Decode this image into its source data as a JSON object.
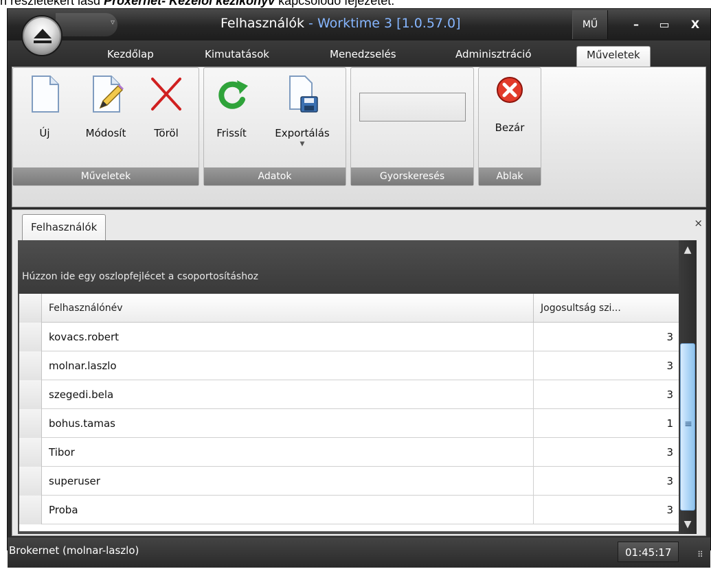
{
  "document_text": {
    "before": "ri részletekért lásd ",
    "bold": "Proxernet- Kezelői kézikönyv",
    "after": " kapcsolódó fejezetét."
  },
  "window": {
    "title": "Felhasználók",
    "separator": " - ",
    "app_name": "Worktime 3",
    "version": " [1.0.57.0]",
    "controls": {
      "extra": "MŰ",
      "minimize": "–",
      "maximize": "▭",
      "close": "X"
    }
  },
  "ribbon_tabs": [
    "Kezdőlap",
    "Kimutatások",
    "Menedzselés",
    "Adminisztráció",
    "Műveletek"
  ],
  "active_tab": "Műveletek",
  "groups": {
    "muveletek": {
      "label": "Műveletek",
      "buttons": {
        "new": "Új",
        "edit": "Módosít",
        "delete": "Töröl"
      }
    },
    "adatok": {
      "label": "Adatok",
      "buttons": {
        "refresh": "Frissít",
        "export": "Exportálás"
      }
    },
    "gyorskereses": {
      "label": "Gyorskeresés"
    },
    "ablak": {
      "label": "Ablak",
      "buttons": {
        "close": "Bezár"
      }
    }
  },
  "document_tab": {
    "label": "Felhasználók",
    "close": "×"
  },
  "grid": {
    "group_panel_text": "Húzzon ide egy oszlopfejlécet a csoportosításhoz",
    "columns": [
      "Felhasználónév",
      "Jogosultság szi..."
    ],
    "rows": [
      {
        "name": "kovacs.robert",
        "value": "3"
      },
      {
        "name": "molnar.laszlo",
        "value": "3"
      },
      {
        "name": "szegedi.bela",
        "value": "3"
      },
      {
        "name": "bohus.tamas",
        "value": "1"
      },
      {
        "name": "Tibor",
        "value": "3"
      },
      {
        "name": "superuser",
        "value": "3"
      },
      {
        "name": "Proba",
        "value": "3"
      }
    ]
  },
  "statusbar": {
    "connection": "Brokernet (molnar-laszlo)",
    "time": "01:45:17"
  },
  "colors": {
    "title_app": "#86b6ff",
    "frame": "#2b2b2b",
    "scroll_thumb": "#a9d2f5",
    "delete_red": "#d02020",
    "refresh_green": "#2fa33a"
  }
}
